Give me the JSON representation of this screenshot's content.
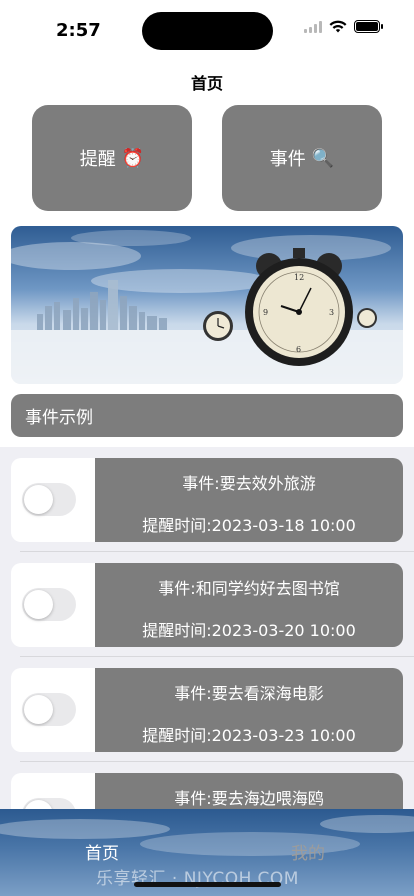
{
  "status_bar": {
    "time": "2:57"
  },
  "nav": {
    "title": "首页"
  },
  "buttons": {
    "remind_label": "提醒",
    "remind_emoji": "⏰",
    "event_label": "事件",
    "event_emoji": "🔍"
  },
  "banner": {
    "clock_icon": "alarm-clock-illustration"
  },
  "section": {
    "title": "事件示例"
  },
  "events": [
    {
      "event": "事件:要去效外旅游",
      "time": "提醒时间:2023-03-18 10:00",
      "enabled": false
    },
    {
      "event": "事件:和同学约好去图书馆",
      "time": "提醒时间:2023-03-20 10:00",
      "enabled": false
    },
    {
      "event": "事件:要去看深海电影",
      "time": "提醒时间:2023-03-23 10:00",
      "enabled": false
    },
    {
      "event": "事件:要去海边喂海鸥",
      "time": "",
      "enabled": false
    }
  ],
  "tabbar": {
    "home_label": "首页",
    "mine_label": "我的",
    "watermark": "乐享轻汇 · NJYCQH.COM"
  },
  "colors": {
    "card_gray": "#7d7d7d",
    "list_bg": "#efeff4"
  }
}
